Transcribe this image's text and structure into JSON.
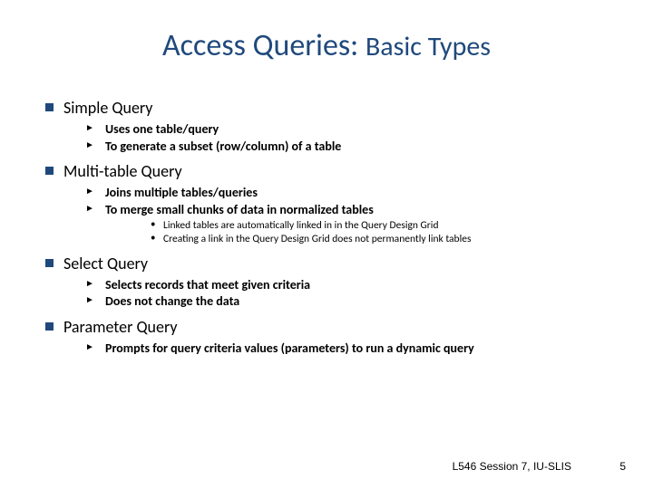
{
  "title_main": "Access Queries:",
  "title_sub": "Basic Types",
  "sections": [
    {
      "heading": "Simple Query",
      "points": [
        {
          "text": "Uses one table/query"
        },
        {
          "text": "To generate a subset (row/column) of a table"
        }
      ]
    },
    {
      "heading": "Multi-table Query",
      "points": [
        {
          "text": "Joins multiple tables/queries"
        },
        {
          "text": "To merge small chunks of data in normalized tables",
          "sub": [
            "Linked tables are automatically linked in in the Query Design Grid",
            "Creating a link in the Query Design Grid does not permanently link tables"
          ]
        }
      ]
    },
    {
      "heading": "Select Query",
      "points": [
        {
          "text": "Selects records that meet given criteria"
        },
        {
          "text": "Does not change the data"
        }
      ]
    },
    {
      "heading": "Parameter Query",
      "points": [
        {
          "text": "Prompts for query criteria values (parameters) to run a dynamic query"
        }
      ]
    }
  ],
  "footer_text": "L546 Session 7, IU-SLIS",
  "slide_number": "5"
}
